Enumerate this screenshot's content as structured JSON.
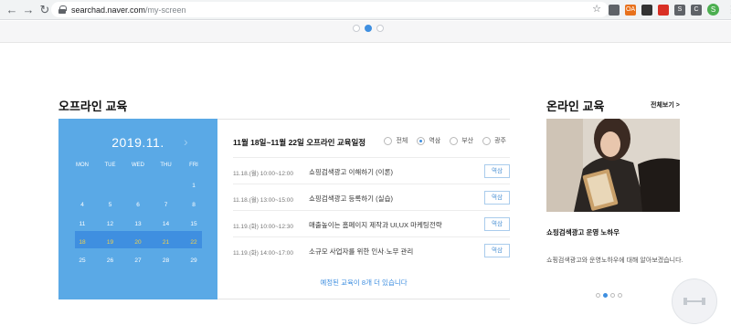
{
  "browser": {
    "url_host": "searchad.naver.com",
    "url_path": "/my-screen",
    "extensions": [
      {
        "name": "puzzle-icon",
        "label": "",
        "color": "#5f6368"
      },
      {
        "name": "ext-orange-icon",
        "label": "OA",
        "color": "#e8711c"
      },
      {
        "name": "ext-circle-icon",
        "label": "",
        "color": "#333333"
      },
      {
        "name": "ext-pdf-icon",
        "label": "",
        "color": "#d93025"
      },
      {
        "name": "ext-grey-s-icon",
        "label": "S",
        "color": "#5f6368"
      },
      {
        "name": "ext-grey-c-icon",
        "label": "C",
        "color": "#5f6368"
      }
    ],
    "profile_initial": "S"
  },
  "offline": {
    "title": "오프라인 교육",
    "calendar": {
      "month": "2019.11.",
      "weekdays": [
        "MON",
        "TUE",
        "WED",
        "THU",
        "FRI"
      ],
      "weeks": [
        [
          "",
          "",
          "",
          "",
          "1"
        ],
        [
          "4",
          "5",
          "6",
          "7",
          "8"
        ],
        [
          "11",
          "12",
          "13",
          "14",
          "15"
        ],
        [
          "18",
          "19",
          "20",
          "21",
          "22"
        ],
        [
          "25",
          "26",
          "27",
          "28",
          "29"
        ]
      ],
      "highlight_week": 3
    },
    "schedule": {
      "title": "11월 18일~11월 22일 오프라인 교육일정",
      "regions": [
        {
          "label": "전체",
          "selected": false
        },
        {
          "label": "역삼",
          "selected": true
        },
        {
          "label": "부산",
          "selected": false
        },
        {
          "label": "광주",
          "selected": false
        }
      ],
      "events": [
        {
          "date": "11.18.(월) 10:00~12:00",
          "title": "쇼핑검색광고 이해하기 (이론)",
          "location": "역삼"
        },
        {
          "date": "11.18.(월) 13:00~15:00",
          "title": "쇼핑검색광고 등록하기 (실습)",
          "location": "역삼"
        },
        {
          "date": "11.19.(화) 10:00~12:30",
          "title": "매출높이는 홈페이지 제작과 UI,UX 마케팅전략",
          "location": "역삼"
        },
        {
          "date": "11.19.(화) 14:00~17:00",
          "title": "소규모 사업자를 위한 인사·노무 관리",
          "location": "역삼"
        }
      ],
      "more_text": "예정된 교육이 8개 더 있습니다"
    }
  },
  "online": {
    "title": "온라인 교육",
    "view_all": "전체보기 >",
    "course_title": "쇼핑검색광고 운영 노하우",
    "course_desc": "쇼핑검색광고와 운영노하우에 대해 알아보겠습니다.",
    "slide_count": 4,
    "active_slide": 1
  },
  "top_band": {
    "slide_count": 3,
    "active_slide": 1
  }
}
